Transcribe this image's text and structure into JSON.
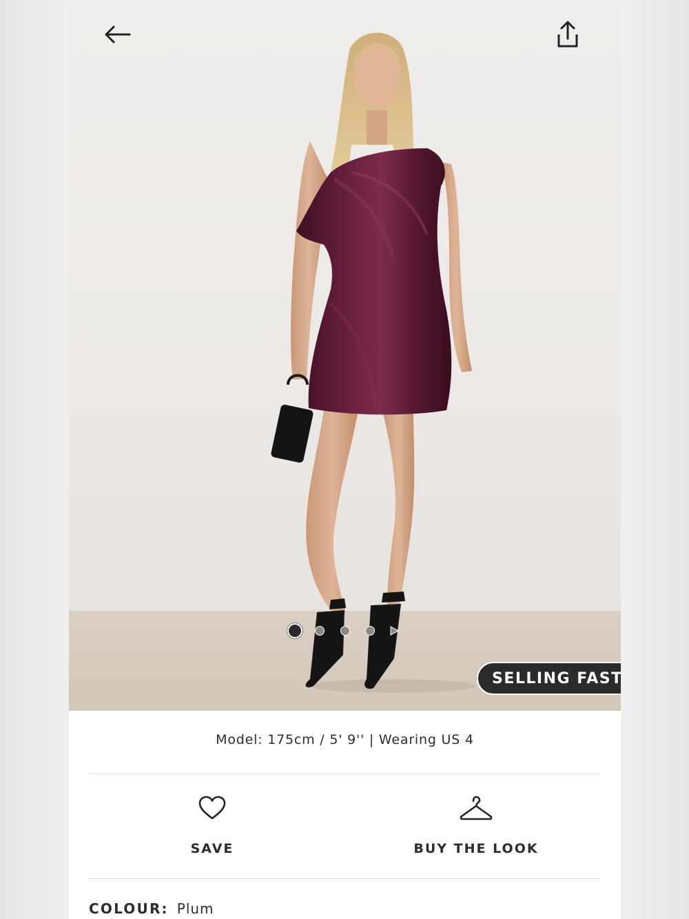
{
  "colors": {
    "dress": "#5a1a33",
    "badge_bg": "#2b2b2b",
    "text": "#2d2d2d"
  },
  "header": {
    "back_icon": "arrow-left-icon",
    "share_icon": "share-icon"
  },
  "gallery": {
    "image_alt_name": "product-photo",
    "page_count": 4,
    "active_index": 1,
    "has_video": true
  },
  "badge": {
    "label": "SELLING FAST"
  },
  "model_info": {
    "text": "Model: 175cm / 5' 9'' | Wearing US 4"
  },
  "actions": {
    "save": {
      "label": "SAVE",
      "icon": "heart-icon"
    },
    "buy_the_look": {
      "label": "BUY THE LOOK",
      "icon": "hanger-icon"
    }
  },
  "colour": {
    "label": "COLOUR:",
    "value": "Plum"
  }
}
